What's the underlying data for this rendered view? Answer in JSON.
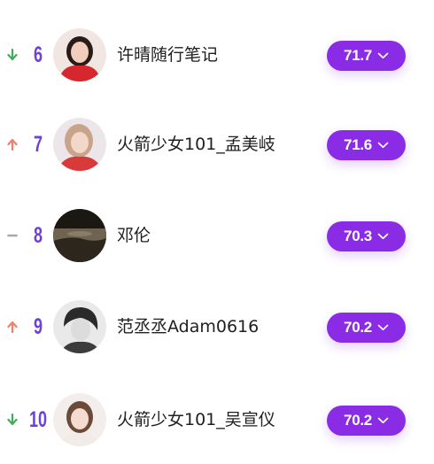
{
  "ranking": {
    "rows": [
      {
        "trend": "down",
        "trend_icon": "arrow-down-icon",
        "trend_color": "#3fae58",
        "rank": "6",
        "name": "许晴随行笔记",
        "score": "71.7"
      },
      {
        "trend": "up",
        "trend_icon": "arrow-up-icon",
        "trend_color": "#ef7e6b",
        "rank": "7",
        "name": "火箭少女101_孟美岐",
        "score": "71.6"
      },
      {
        "trend": "same",
        "trend_icon": "dash-icon",
        "trend_color": "#a8a8a8",
        "rank": "8",
        "name": "邓伦",
        "score": "70.3"
      },
      {
        "trend": "up",
        "trend_icon": "arrow-up-icon",
        "trend_color": "#ef7e6b",
        "rank": "9",
        "name": "范丞丞Adam0616",
        "score": "70.2"
      },
      {
        "trend": "down",
        "trend_icon": "arrow-down-icon",
        "trend_color": "#3fae58",
        "rank": "10",
        "name": "火箭少女101_吴宣仪",
        "score": "70.2"
      }
    ],
    "dropdown_icon": "chevron-down-icon",
    "accent_color": "#8a2be6",
    "rank_color": "#6e3fd9"
  }
}
